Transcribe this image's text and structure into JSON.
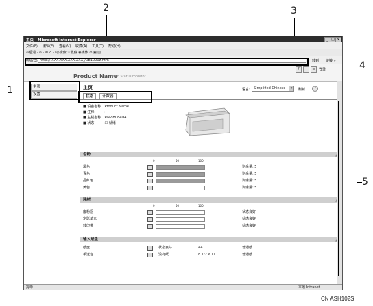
{
  "window": {
    "title": "主页 - Microsoft Internet Explorer",
    "menu": [
      "文件(F)",
      "编辑(E)",
      "查看(V)",
      "收藏(A)",
      "工具(T)",
      "帮助(H)"
    ],
    "toolbar": "⇦后退 · ⇨ · ⊗ ⌂ ⊡ ◎搜索 ☆收藏 ◉媒体 ⊙ ▣ ▤",
    "address_label": "地址(D)",
    "address_value": "http://(XXX.XXX.XXX.XXX)/DE1000z.htm",
    "go_label": "转到",
    "links_label": "链接 »"
  },
  "page": {
    "product_name": "Product Name",
    "subtitle": "Web Status monitor",
    "top_icons": [
      "?",
      "i",
      "≡"
    ],
    "top_link": "登录"
  },
  "sidebar": {
    "items": [
      {
        "label": "主页"
      },
      {
        "label": "设置"
      }
    ]
  },
  "main": {
    "title": "主页",
    "language_label": "语言:",
    "language_value": "Simplified Chinese",
    "refresh_label": "刷新",
    "help_icon": "?",
    "tabs": [
      {
        "label": "状态"
      },
      {
        "label": "计数器"
      }
    ],
    "info": [
      {
        "key": "■ 设备名称",
        "value": ":Product Name"
      },
      {
        "key": "■ 注释",
        "value": ":"
      },
      {
        "key": "■ 主机名称",
        "value": ":RNP-B084D4"
      },
      {
        "key": "■ 状态",
        "value": ":☐ 就绪"
      }
    ]
  },
  "toner": {
    "title": "色粉",
    "scale": [
      "0",
      "50",
      "100"
    ],
    "rows": [
      {
        "label": "黑色",
        "level": 1.0,
        "status": "剩余量: 5"
      },
      {
        "label": "青色",
        "level": 1.0,
        "status": "剩余量: 5"
      },
      {
        "label": "品红色",
        "level": 1.0,
        "status": "剩余量: 5"
      },
      {
        "label": "黄色",
        "level": 0.0,
        "status": "剩余量: 5"
      }
    ]
  },
  "consumables": {
    "title": "耗材",
    "scale": [
      "0",
      "50",
      "100"
    ],
    "rows": [
      {
        "label": "废粉瓶",
        "level": 0.0,
        "status": "状态良好"
      },
      {
        "label": "定影单元",
        "level": 0.0,
        "status": "状态良好"
      },
      {
        "label": "转印带",
        "level": 0.0,
        "status": "状态良好"
      }
    ]
  },
  "input_tray": {
    "title": "输入纸盘",
    "rows": [
      {
        "label": "纸盘1",
        "status": "状态良好",
        "size": "A4",
        "type": "普通纸"
      },
      {
        "label": "手送台",
        "status": "没有纸",
        "size": "8 1/2 x 11",
        "type": "普通纸"
      }
    ]
  },
  "statusbar": {
    "left": "完毕",
    "zone": "本地 Intranet"
  },
  "callouts": [
    "1",
    "2",
    "3",
    "4",
    "5"
  ],
  "code": "CN ASH102S"
}
